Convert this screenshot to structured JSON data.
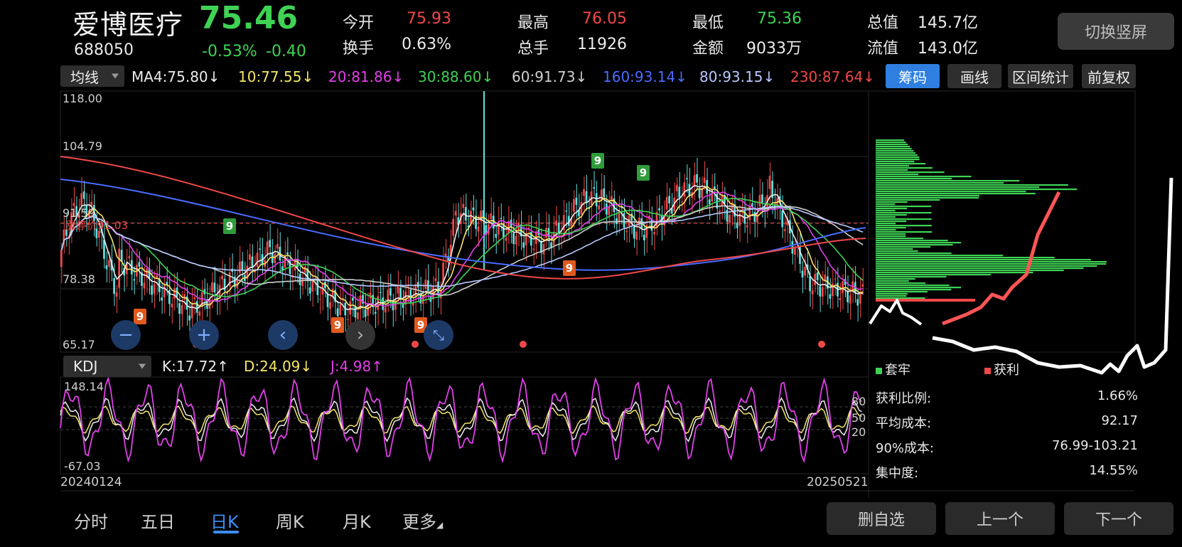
{
  "header": {
    "name": "爱博医疗",
    "price": "75.46",
    "code": "688050",
    "change_pct": "-0.53%",
    "change": "-0.40",
    "stats": [
      {
        "label": "今开",
        "value": "75.93",
        "color": "red"
      },
      {
        "label": "换手",
        "value": "0.63%",
        "color": "white"
      },
      {
        "label": "最高",
        "value": "76.05",
        "color": "red"
      },
      {
        "label": "总手",
        "value": "11926",
        "color": "white"
      },
      {
        "label": "最低",
        "value": "75.36",
        "color": "green"
      },
      {
        "label": "金额",
        "value": "9033万",
        "color": "white"
      },
      {
        "label": "总值",
        "value": "145.7亿",
        "color": "white"
      },
      {
        "label": "流值",
        "value": "143.0亿",
        "color": "white"
      }
    ],
    "switch_label": "切换竖屏"
  },
  "toolbar": {
    "indicator": "均线",
    "ma": [
      {
        "text": "MA4:75.80↓",
        "color": "#ececec"
      },
      {
        "text": "10:77.55↓",
        "color": "#f5e66a"
      },
      {
        "text": "20:81.86↓",
        "color": "#e040e8"
      },
      {
        "text": "30:88.60↓",
        "color": "#3fd255"
      },
      {
        "text": "60:91.73↓",
        "color": "#cfcfcf"
      },
      {
        "text": "160:93.14↓",
        "color": "#4a6cff"
      },
      {
        "text": "80:93.15↓",
        "color": "#b8c8ff"
      },
      {
        "text": "230:87.64↓",
        "color": "#f04848"
      }
    ],
    "buttons": [
      "筹码",
      "画线",
      "区间统计",
      "前复权"
    ]
  },
  "main_chart": {
    "y_labels": [
      "118.00",
      "104.79",
      "91.59",
      "78.38",
      "65.17"
    ],
    "limit_label": "涨停价91.03"
  },
  "kdj": {
    "indicator": "KDJ",
    "k": "K:17.72↑",
    "d": "D:24.09↓",
    "j": "J:4.98↑",
    "y_max": "148.14",
    "y_min": "-67.03",
    "levels": [
      "80",
      "50",
      "20"
    ],
    "start_date": "20240124",
    "end_date": "20250521"
  },
  "chips": {
    "legend_trapped": "套牢",
    "legend_profit": "获利",
    "rows": [
      {
        "label": "获利比例:",
        "value": "1.66%"
      },
      {
        "label": "平均成本:",
        "value": "92.17"
      },
      {
        "label": "90%成本:",
        "value": "76.99-103.21"
      },
      {
        "label": "集中度:",
        "value": "14.55%"
      }
    ]
  },
  "tabs": [
    "分时",
    "五日",
    "日K",
    "周K",
    "月K",
    "更多"
  ],
  "bottom_buttons": [
    "删自选",
    "上一个",
    "下一个"
  ],
  "colors": {
    "up": "#f04848",
    "down": "#3fd255",
    "accent": "#2f7fe0"
  }
}
